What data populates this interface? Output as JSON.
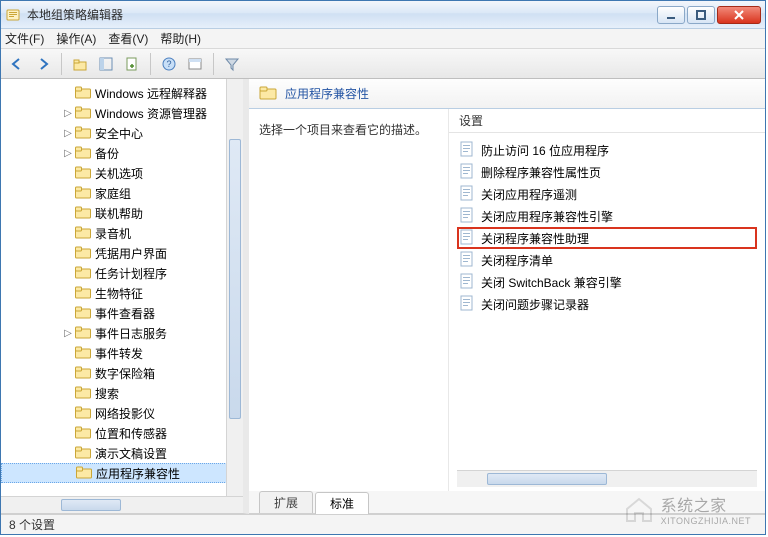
{
  "window": {
    "title": "本地组策略编辑器"
  },
  "menu": {
    "file": "文件(F)",
    "action": "操作(A)",
    "view": "查看(V)",
    "help": "帮助(H)"
  },
  "tree": {
    "items": [
      {
        "label": "Windows 远程解释器",
        "expandable": false
      },
      {
        "label": "Windows 资源管理器",
        "expandable": true
      },
      {
        "label": "安全中心",
        "expandable": true
      },
      {
        "label": "备份",
        "expandable": true
      },
      {
        "label": "关机选项",
        "expandable": false
      },
      {
        "label": "家庭组",
        "expandable": false
      },
      {
        "label": "联机帮助",
        "expandable": false
      },
      {
        "label": "录音机",
        "expandable": false
      },
      {
        "label": "凭据用户界面",
        "expandable": false
      },
      {
        "label": "任务计划程序",
        "expandable": false
      },
      {
        "label": "生物特征",
        "expandable": false
      },
      {
        "label": "事件查看器",
        "expandable": false
      },
      {
        "label": "事件日志服务",
        "expandable": true
      },
      {
        "label": "事件转发",
        "expandable": false
      },
      {
        "label": "数字保险箱",
        "expandable": false
      },
      {
        "label": "搜索",
        "expandable": false
      },
      {
        "label": "网络投影仪",
        "expandable": false
      },
      {
        "label": "位置和传感器",
        "expandable": false
      },
      {
        "label": "演示文稿设置",
        "expandable": false
      },
      {
        "label": "应用程序兼容性",
        "expandable": false,
        "selected": true
      }
    ]
  },
  "right": {
    "header_title": "应用程序兼容性",
    "description_hint": "选择一个项目来查看它的描述。",
    "settings_header": "设置",
    "items": [
      {
        "label": "防止访问 16 位应用程序"
      },
      {
        "label": "删除程序兼容性属性页"
      },
      {
        "label": "关闭应用程序遥测"
      },
      {
        "label": "关闭应用程序兼容性引擎"
      },
      {
        "label": "关闭程序兼容性助理",
        "highlight": true
      },
      {
        "label": "关闭程序清单"
      },
      {
        "label": "关闭 SwitchBack 兼容引擎"
      },
      {
        "label": "关闭问题步骤记录器"
      }
    ]
  },
  "tabs": {
    "extended": "扩展",
    "standard": "标准"
  },
  "status": {
    "count_label": "8 个设置"
  },
  "watermark": {
    "text": "系统之家",
    "url": "XITONGZHIJIA.NET"
  }
}
